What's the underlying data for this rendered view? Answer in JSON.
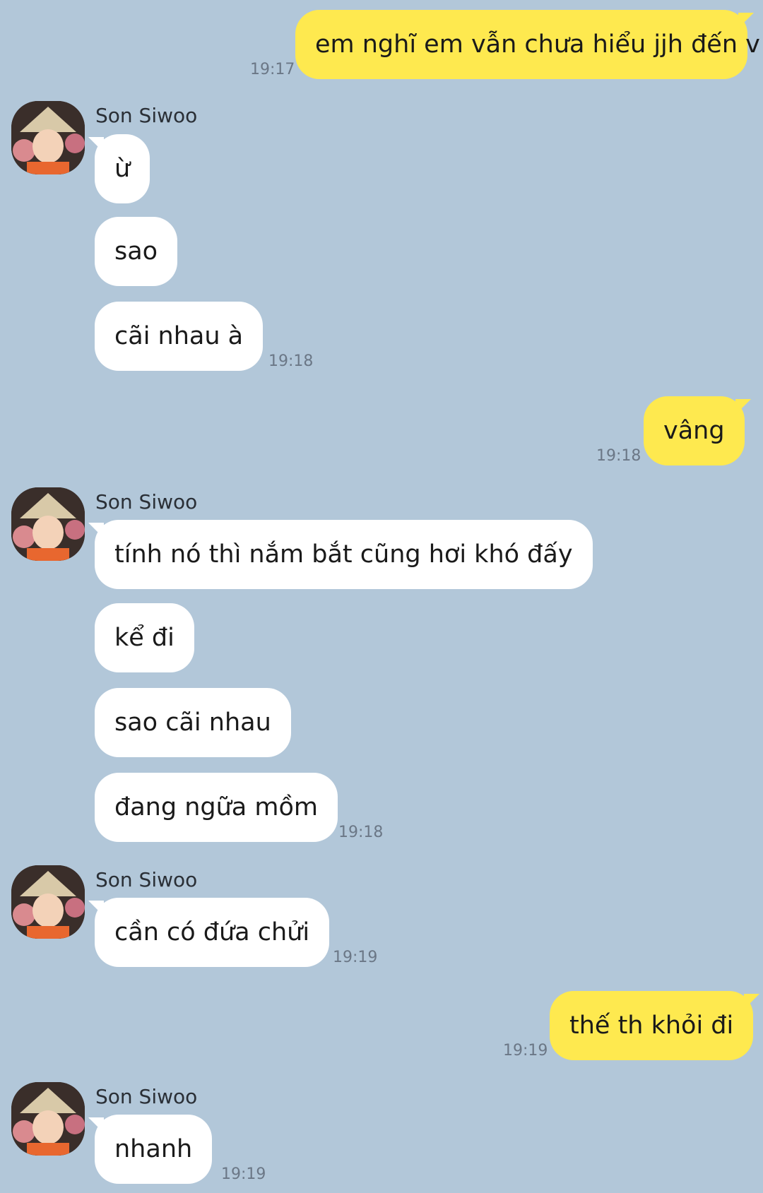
{
  "contact": {
    "name": "Son Siwoo"
  },
  "messages": [
    {
      "id": "m1",
      "dir": "out",
      "text": "em nghĩ em vẫn chưa hiểu jjh đến v",
      "time": "19:17"
    },
    {
      "id": "m2",
      "dir": "in",
      "text": "ừ",
      "time": ""
    },
    {
      "id": "m3",
      "dir": "in",
      "text": "sao",
      "time": ""
    },
    {
      "id": "m4",
      "dir": "in",
      "text": "cãi nhau à",
      "time": "19:18"
    },
    {
      "id": "m5",
      "dir": "out",
      "text": "vâng",
      "time": "19:18"
    },
    {
      "id": "m6",
      "dir": "in",
      "text": "tính nó thì nắm bắt cũng hơi khó đấy",
      "time": ""
    },
    {
      "id": "m7",
      "dir": "in",
      "text": "kể đi",
      "time": ""
    },
    {
      "id": "m8",
      "dir": "in",
      "text": "sao cãi nhau",
      "time": ""
    },
    {
      "id": "m9",
      "dir": "in",
      "text": "đang ngữa mồm",
      "time": "19:18"
    },
    {
      "id": "m10",
      "dir": "in",
      "text": "cần có đứa chửi",
      "time": "19:19"
    },
    {
      "id": "m11",
      "dir": "out",
      "text": "thế th khỏi đi",
      "time": "19:19"
    },
    {
      "id": "m12",
      "dir": "in",
      "text": "nhanh",
      "time": "19:19"
    }
  ],
  "colors": {
    "background": "#b2c7d9",
    "outgoing_bubble": "#fee94f",
    "incoming_bubble": "#ffffff",
    "timestamp": "#6b7786"
  }
}
